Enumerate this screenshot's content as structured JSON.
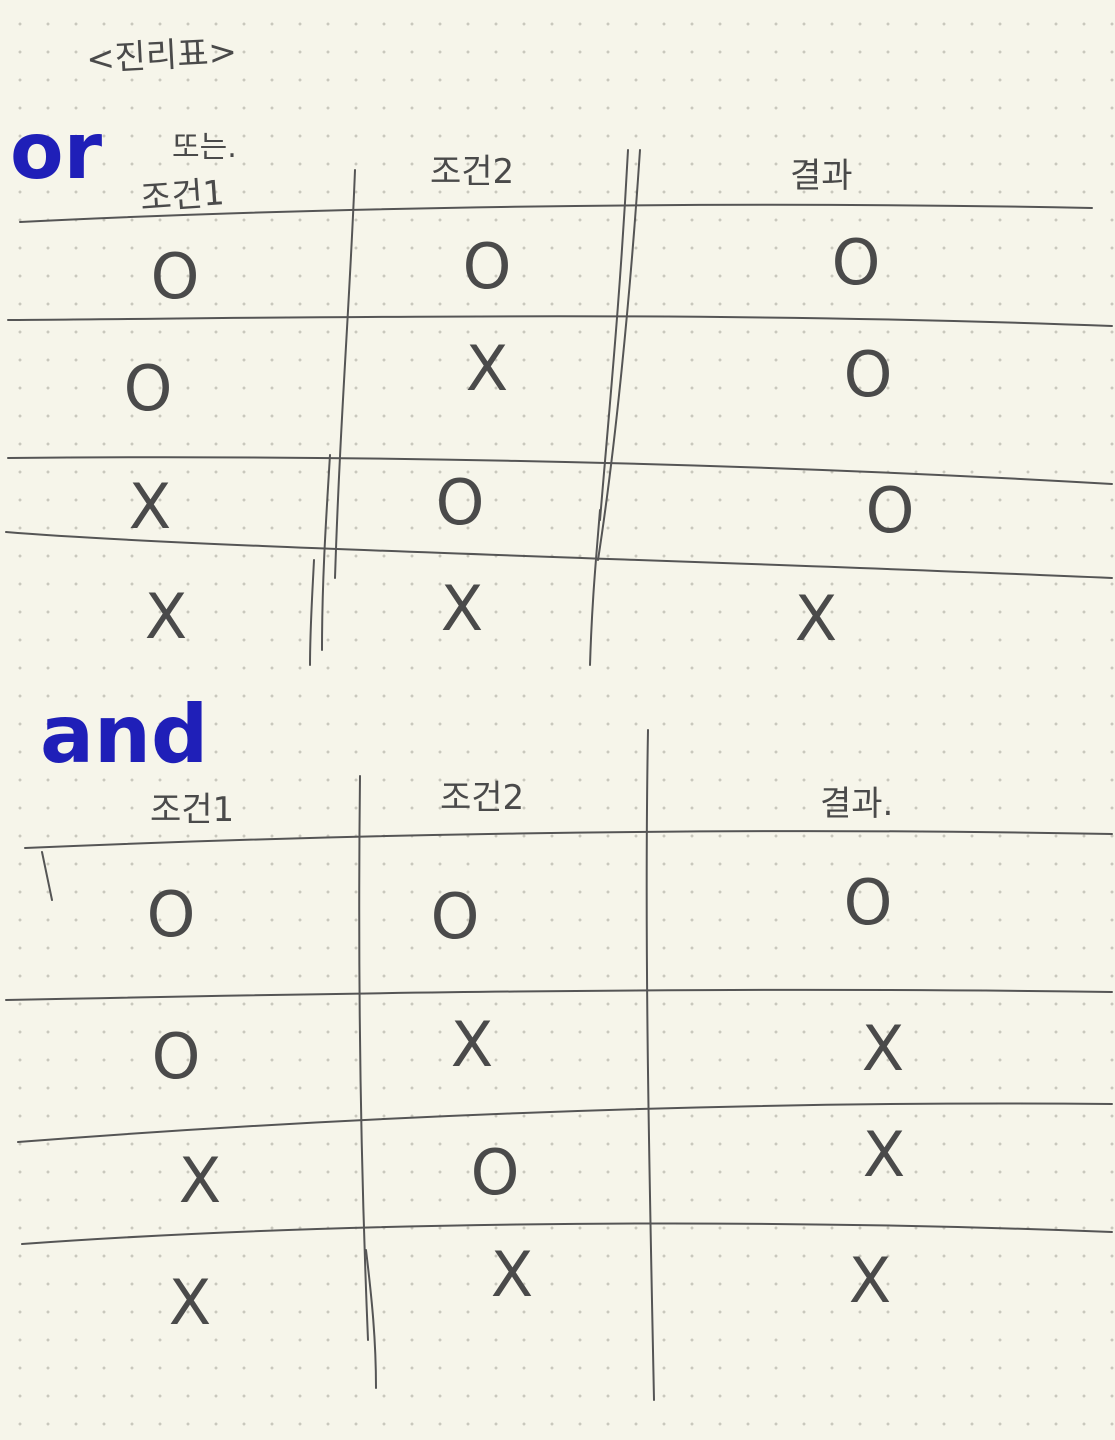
{
  "page_title": "<진리표>",
  "tables": [
    {
      "operator": "or",
      "note": "또는.",
      "headers": [
        "조건1",
        "조건2",
        "결과"
      ],
      "rows": [
        [
          "O",
          "O",
          "O"
        ],
        [
          "O",
          "X",
          "O"
        ],
        [
          "X",
          "O",
          "O"
        ],
        [
          "X",
          "X",
          "X"
        ]
      ]
    },
    {
      "operator": "and",
      "note": "",
      "headers": [
        "조건1",
        "조건2",
        "결과."
      ],
      "rows": [
        [
          "O",
          "O",
          "O"
        ],
        [
          "O",
          "X",
          "X"
        ],
        [
          "X",
          "O",
          "X"
        ],
        [
          "X",
          "X",
          "X"
        ]
      ]
    }
  ],
  "colors": {
    "ink": "#4a4a4a",
    "pen_blue": "#1f1fb8",
    "paper": "#f6f5ea"
  }
}
